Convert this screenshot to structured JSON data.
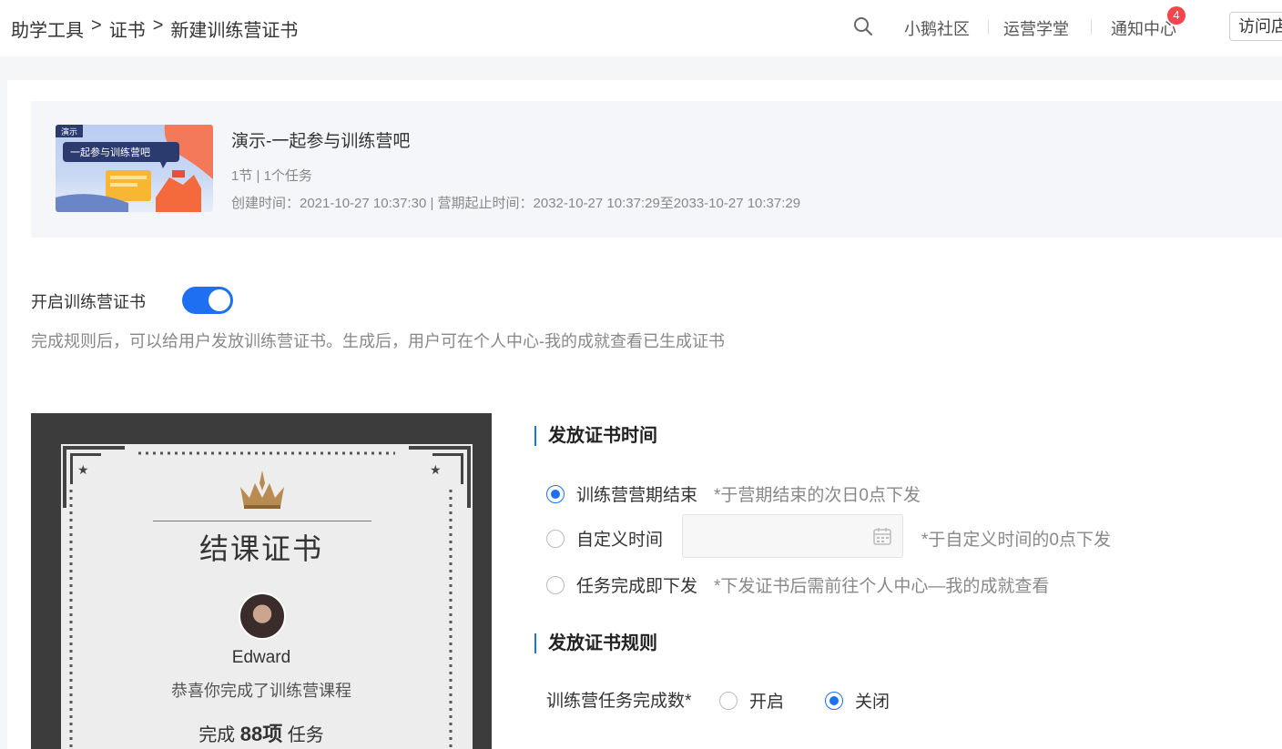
{
  "breadcrumb": {
    "root": "助学工具",
    "sep1": ">",
    "mid": "证书",
    "sep2": ">",
    "current": "新建训练营证书"
  },
  "header": {
    "community": "小鹅社区",
    "academy": "运营学堂",
    "notifications": "通知中心",
    "notification_count": "4",
    "visit": "访问店"
  },
  "course": {
    "thumb_tag": "演示",
    "thumb_caption": "一起参与训练营吧",
    "title": "演示-一起参与训练营吧",
    "meta": "1节 | 1个任务",
    "time": "创建时间：2021-10-27 10:37:30  |  营期起止时间：2032-10-27 10:37:29至2033-10-27 10:37:29"
  },
  "toggle": {
    "label": "开启训练营证书",
    "enabled": true,
    "desc": "完成规则后，可以给用户发放训练营证书。生成后，用户可在个人中心-我的成就查看已生成证书"
  },
  "certificate": {
    "title": "结课证书",
    "name": "Edward",
    "congrats": "恭喜你完成了训练营课程",
    "complete_prefix": "完成",
    "complete_count": "88项",
    "complete_suffix": "任务"
  },
  "issue_time": {
    "title": "发放证书时间",
    "options": [
      {
        "label": "训练营营期结束",
        "hint": "*于营期结束的次日0点下发",
        "checked": true
      },
      {
        "label": "自定义时间",
        "hint": "*于自定义时间的0点下发",
        "checked": false
      },
      {
        "label": "任务完成即下发",
        "hint": "*下发证书后需前往个人中心—我的成就查看",
        "checked": false
      }
    ]
  },
  "issue_rule": {
    "title": "发放证书规则",
    "task_count_label": "训练营任务完成数*",
    "on_label": "开启",
    "off_label": "关闭",
    "selected": "关闭"
  },
  "colors": {
    "accent": "#1e6ff1",
    "badge": "#f5454b"
  }
}
